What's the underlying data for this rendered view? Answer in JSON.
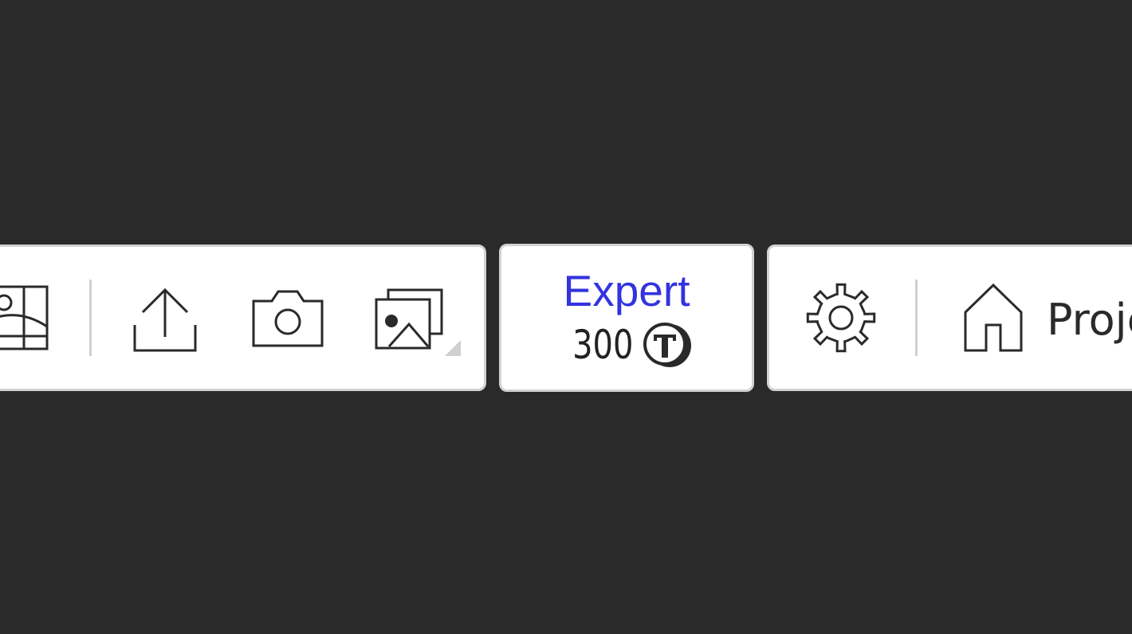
{
  "toolbar": {
    "tools": [
      {
        "name": "floor-plan",
        "icon": "floor-plan-icon"
      },
      {
        "name": "upload",
        "icon": "upload-icon"
      },
      {
        "name": "camera",
        "icon": "camera-icon"
      },
      {
        "name": "gallery",
        "icon": "gallery-icon",
        "has_submenu": true
      }
    ]
  },
  "plan": {
    "label": "Expert",
    "credits": "300",
    "credit_icon": "token-icon",
    "label_color": "#3333e0"
  },
  "right_toolbar": {
    "settings_icon": "gear-icon",
    "home_icon": "home-icon",
    "home_label": "Projects"
  },
  "colors": {
    "background": "#2a2a2a",
    "panel": "#ffffff",
    "panel_border": "#d2d2d2",
    "icon_stroke": "#2a2a2a"
  }
}
